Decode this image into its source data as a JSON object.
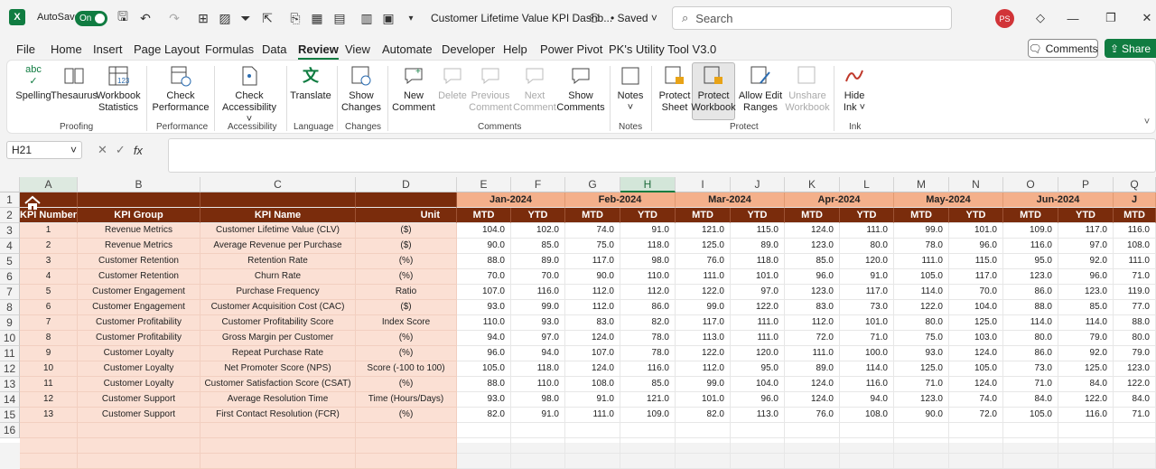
{
  "titlebar": {
    "app_icon": "excel-icon",
    "autosave_label": "AutoSave",
    "autosave_state": "On",
    "doc_title": "Customer Lifetime Value KPI Dashb...",
    "saved_label": "• Saved",
    "search_placeholder": "Search",
    "avatar_initials": "PS"
  },
  "menu": [
    "File",
    "Home",
    "Insert",
    "Page Layout",
    "Formulas",
    "Data",
    "Review",
    "View",
    "Automate",
    "Developer",
    "Help",
    "Power Pivot",
    "PK's Utility Tool V3.0"
  ],
  "menu_active": "Review",
  "comments_btn": "Comments",
  "share_btn": "Share",
  "ribbon": {
    "spelling": "Spelling",
    "thesaurus": "Thesaurus",
    "workbook_stats_1": "Workbook",
    "workbook_stats_2": "Statistics",
    "check_perf_1": "Check",
    "check_perf_2": "Performance",
    "check_acc_1": "Check",
    "check_acc_2": "Accessibility ˅",
    "translate": "Translate",
    "show_changes_1": "Show",
    "show_changes_2": "Changes",
    "new_comment_1": "New",
    "new_comment_2": "Comment",
    "delete": "Delete",
    "previous_1": "Previous",
    "previous_2": "Comment",
    "next_1": "Next",
    "next_2": "Comment",
    "show_comments_1": "Show",
    "show_comments_2": "Comments",
    "notes": "Notes",
    "notes_chev": "˅",
    "protect_sheet_1": "Protect",
    "protect_sheet_2": "Sheet",
    "protect_wb_1": "Protect",
    "protect_wb_2": "Workbook",
    "allow_edit_1": "Allow Edit",
    "allow_edit_2": "Ranges",
    "unshare_1": "Unshare",
    "unshare_2": "Workbook",
    "hide_ink_1": "Hide",
    "hide_ink_2": "Ink ˅",
    "groups": {
      "proofing": "Proofing",
      "performance": "Performance",
      "accessibility": "Accessibility",
      "language": "Language",
      "changes": "Changes",
      "comments": "Comments",
      "notes": "Notes",
      "protect": "Protect",
      "ink": "Ink"
    }
  },
  "formula_bar": {
    "name_box": "H21",
    "fx": "fx"
  },
  "columns": [
    "A",
    "B",
    "C",
    "D",
    "E",
    "F",
    "G",
    "H",
    "I",
    "J",
    "K",
    "L",
    "M",
    "N",
    "O",
    "P",
    "Q"
  ],
  "selected_column": "H",
  "header_row2": {
    "kpi_number": "KPI Number",
    "kpi_group": "KPI Group",
    "kpi_name": "KPI Name",
    "unit": "Unit",
    "mtd": "MTD",
    "ytd": "YTD"
  },
  "months": [
    "Jan-2024",
    "Feb-2024",
    "Mar-2024",
    "Apr-2024",
    "May-2024",
    "Jun-2024",
    "J"
  ],
  "rows": [
    {
      "n": "1",
      "group": "Revenue Metrics",
      "name": "Customer Lifetime Value (CLV)",
      "unit": "($)",
      "vals": [
        "104.0",
        "102.0",
        "74.0",
        "91.0",
        "121.0",
        "115.0",
        "124.0",
        "111.0",
        "99.0",
        "101.0",
        "109.0",
        "117.0",
        "116.0"
      ]
    },
    {
      "n": "2",
      "group": "Revenue Metrics",
      "name": "Average Revenue per Purchase",
      "unit": "($)",
      "vals": [
        "90.0",
        "85.0",
        "75.0",
        "118.0",
        "125.0",
        "89.0",
        "123.0",
        "80.0",
        "78.0",
        "96.0",
        "116.0",
        "97.0",
        "108.0"
      ]
    },
    {
      "n": "3",
      "group": "Customer Retention",
      "name": "Retention Rate",
      "unit": "(%)",
      "vals": [
        "88.0",
        "89.0",
        "117.0",
        "98.0",
        "76.0",
        "118.0",
        "85.0",
        "120.0",
        "111.0",
        "115.0",
        "95.0",
        "92.0",
        "111.0"
      ]
    },
    {
      "n": "4",
      "group": "Customer Retention",
      "name": "Churn Rate",
      "unit": "(%)",
      "vals": [
        "70.0",
        "70.0",
        "90.0",
        "110.0",
        "111.0",
        "101.0",
        "96.0",
        "91.0",
        "105.0",
        "117.0",
        "123.0",
        "96.0",
        "71.0"
      ]
    },
    {
      "n": "5",
      "group": "Customer Engagement",
      "name": "Purchase Frequency",
      "unit": "Ratio",
      "vals": [
        "107.0",
        "116.0",
        "112.0",
        "112.0",
        "122.0",
        "97.0",
        "123.0",
        "117.0",
        "114.0",
        "70.0",
        "86.0",
        "123.0",
        "119.0"
      ]
    },
    {
      "n": "6",
      "group": "Customer Engagement",
      "name": "Customer Acquisition Cost (CAC)",
      "unit": "($)",
      "vals": [
        "93.0",
        "99.0",
        "112.0",
        "86.0",
        "99.0",
        "122.0",
        "83.0",
        "73.0",
        "122.0",
        "104.0",
        "88.0",
        "85.0",
        "77.0"
      ]
    },
    {
      "n": "7",
      "group": "Customer Profitability",
      "name": "Customer Profitability Score",
      "unit": "Index Score",
      "vals": [
        "110.0",
        "93.0",
        "83.0",
        "82.0",
        "117.0",
        "111.0",
        "112.0",
        "101.0",
        "80.0",
        "125.0",
        "114.0",
        "114.0",
        "88.0"
      ]
    },
    {
      "n": "8",
      "group": "Customer Profitability",
      "name": "Gross Margin per Customer",
      "unit": "(%)",
      "vals": [
        "94.0",
        "97.0",
        "124.0",
        "78.0",
        "113.0",
        "111.0",
        "72.0",
        "71.0",
        "75.0",
        "103.0",
        "80.0",
        "79.0",
        "80.0"
      ]
    },
    {
      "n": "9",
      "group": "Customer Loyalty",
      "name": "Repeat Purchase Rate",
      "unit": "(%)",
      "vals": [
        "96.0",
        "94.0",
        "107.0",
        "78.0",
        "122.0",
        "120.0",
        "111.0",
        "100.0",
        "93.0",
        "124.0",
        "86.0",
        "92.0",
        "79.0"
      ]
    },
    {
      "n": "10",
      "group": "Customer Loyalty",
      "name": "Net Promoter Score (NPS)",
      "unit": "Score (-100 to 100)",
      "vals": [
        "105.0",
        "118.0",
        "124.0",
        "116.0",
        "112.0",
        "95.0",
        "89.0",
        "114.0",
        "125.0",
        "105.0",
        "73.0",
        "125.0",
        "123.0"
      ]
    },
    {
      "n": "11",
      "group": "Customer Loyalty",
      "name": "Customer Satisfaction Score (CSAT)",
      "unit": "(%)",
      "vals": [
        "88.0",
        "110.0",
        "108.0",
        "85.0",
        "99.0",
        "104.0",
        "124.0",
        "116.0",
        "71.0",
        "124.0",
        "71.0",
        "84.0",
        "122.0"
      ]
    },
    {
      "n": "12",
      "group": "Customer Support",
      "name": "Average Resolution Time",
      "unit": "Time (Hours/Days)",
      "vals": [
        "93.0",
        "98.0",
        "91.0",
        "121.0",
        "101.0",
        "96.0",
        "124.0",
        "94.0",
        "123.0",
        "74.0",
        "84.0",
        "122.0",
        "84.0"
      ]
    },
    {
      "n": "13",
      "group": "Customer Support",
      "name": "First Contact Resolution (FCR)",
      "unit": "(%)",
      "vals": [
        "82.0",
        "91.0",
        "111.0",
        "109.0",
        "82.0",
        "113.0",
        "76.0",
        "108.0",
        "90.0",
        "72.0",
        "105.0",
        "116.0",
        "71.0"
      ]
    }
  ],
  "row_numbers": [
    "1",
    "2",
    "3",
    "4",
    "5",
    "6",
    "7",
    "8",
    "9",
    "10",
    "11",
    "12",
    "13",
    "14",
    "15",
    "16"
  ]
}
